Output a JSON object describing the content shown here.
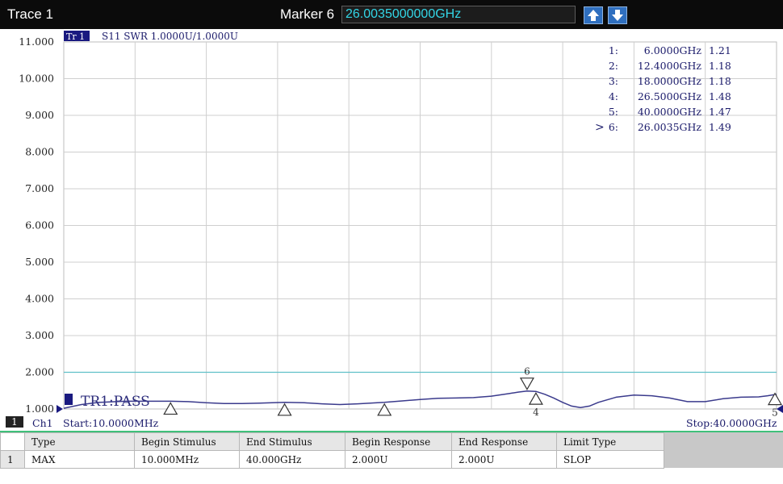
{
  "header": {
    "trace_title": "Trace 1",
    "marker_label": "Marker 6",
    "marker_value": "26.0035000000GHz",
    "up_icon": "arrow-up-icon",
    "down_icon": "arrow-down-icon"
  },
  "plot_header": {
    "trace_tag": "Tr 1",
    "trace_info": "S11 SWR 1.0000U/1.0000U",
    "pass_label": "TR1:PASS"
  },
  "chart_data": {
    "type": "line",
    "title": "",
    "xlabel": "",
    "ylabel": "",
    "xlim": [
      0.01,
      40.0
    ],
    "ylim": [
      1.0,
      11.0
    ],
    "y_ticks": [
      "11.000",
      "10.000",
      "9.000",
      "8.000",
      "7.000",
      "6.000",
      "5.000",
      "4.000",
      "3.000",
      "2.000",
      "1.000"
    ],
    "grid": true,
    "limit_line": 2.0,
    "series": [
      {
        "x": [
          0.01,
          1.0,
          2.0,
          3.5,
          5.0,
          6.0,
          7.0,
          8.0,
          9.0,
          10.0,
          11.0,
          12.4,
          13.5,
          14.5,
          15.5,
          16.5,
          18.0,
          19.0,
          20.0,
          21.0,
          22.0,
          23.0,
          24.0,
          25.0,
          25.5,
          26.0,
          26.5,
          27.0,
          27.5,
          28.0,
          28.5,
          29.0,
          29.5,
          30.0,
          31.0,
          32.0,
          33.0,
          34.0,
          35.0,
          36.0,
          37.0,
          38.0,
          39.0,
          39.5,
          40.0
        ],
        "values": [
          1.02,
          1.12,
          1.18,
          1.21,
          1.21,
          1.21,
          1.2,
          1.17,
          1.15,
          1.15,
          1.16,
          1.18,
          1.17,
          1.14,
          1.12,
          1.14,
          1.18,
          1.22,
          1.26,
          1.29,
          1.3,
          1.31,
          1.35,
          1.42,
          1.46,
          1.49,
          1.48,
          1.4,
          1.3,
          1.18,
          1.08,
          1.04,
          1.08,
          1.18,
          1.32,
          1.38,
          1.36,
          1.3,
          1.2,
          1.2,
          1.28,
          1.32,
          1.33,
          1.36,
          1.4
        ]
      }
    ],
    "markers": [
      {
        "id": "1",
        "freq": "6.0000GHz",
        "value": "1.21",
        "x": 6.0,
        "y": 1.21
      },
      {
        "id": "2",
        "freq": "12.4000GHz",
        "value": "1.18",
        "x": 12.4,
        "y": 1.18
      },
      {
        "id": "3",
        "freq": "18.0000GHz",
        "value": "1.18",
        "x": 18.0,
        "y": 1.18
      },
      {
        "id": "4",
        "freq": "26.5000GHz",
        "value": "1.48",
        "x": 26.5,
        "y": 1.48
      },
      {
        "id": "5",
        "freq": "40.0000GHz",
        "value": "1.47",
        "x": 40.0,
        "y": 1.47
      },
      {
        "id": "6",
        "freq": "26.0035GHz",
        "value": "1.49",
        "x": 26.0035,
        "y": 1.49,
        "active": true
      }
    ],
    "colors": {
      "trace": "#3a3a8c",
      "limit": "#5fc0c8",
      "grid": "#cfcfcf",
      "text": "#1a1a6a"
    }
  },
  "status": {
    "channel_num": "1",
    "channel_label": "Ch1",
    "start": "Start:10.0000MHz",
    "stop": "Stop:40.0000GHz"
  },
  "limit_table": {
    "headers": [
      "Type",
      "Begin Stimulus",
      "End Stimulus",
      "Begin Response",
      "End Response",
      "Limit Type"
    ],
    "rows": [
      {
        "index": "1",
        "cells": [
          "MAX",
          "10.000MHz",
          "40.000GHz",
          "2.000U",
          "2.000U",
          "SLOP"
        ]
      }
    ]
  }
}
